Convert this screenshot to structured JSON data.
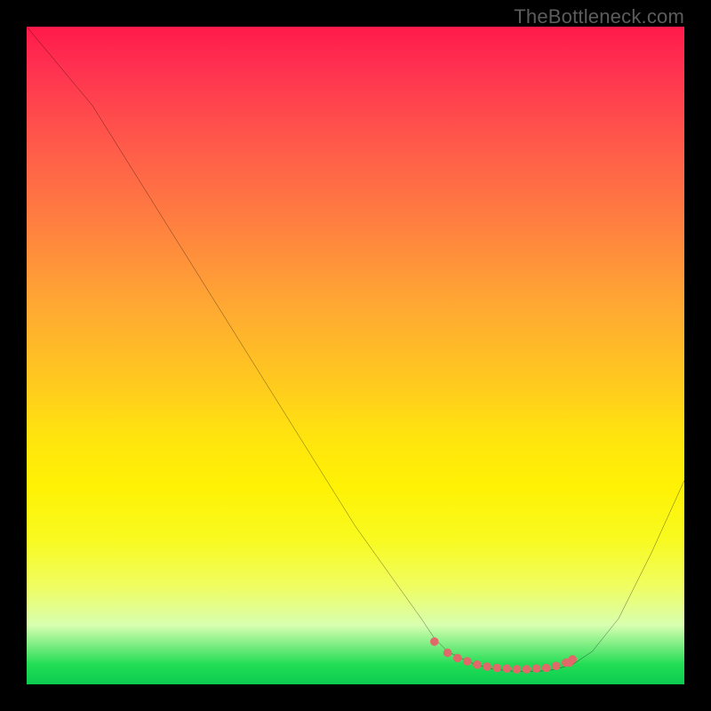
{
  "watermark": "TheBottleneck.com",
  "chart_data": {
    "type": "line",
    "title": "",
    "xlabel": "",
    "ylabel": "",
    "xlim": [
      0,
      100
    ],
    "ylim": [
      0,
      100
    ],
    "grid": false,
    "legend": false,
    "series": [
      {
        "name": "bottleneck-curve",
        "x": [
          0,
          5,
          10,
          15,
          20,
          25,
          30,
          35,
          40,
          45,
          50,
          55,
          60,
          62,
          64,
          67,
          70,
          72,
          74,
          76,
          78,
          80,
          83,
          86,
          90,
          95,
          100
        ],
        "y": [
          100,
          94,
          88,
          80,
          72,
          64,
          56,
          48,
          40,
          32,
          24,
          17,
          10,
          7,
          5,
          3.5,
          2.5,
          2.2,
          2.0,
          2.0,
          2.0,
          2.2,
          3.0,
          5.0,
          10,
          20,
          31
        ]
      }
    ],
    "highlight": {
      "name": "optimal-range-dots",
      "x": [
        62,
        64,
        65.5,
        67,
        68.5,
        70,
        71.5,
        73,
        74.5,
        76,
        77.5,
        79,
        80.5,
        82,
        82.5,
        83
      ],
      "y": [
        6.5,
        4.8,
        4.0,
        3.5,
        3.0,
        2.7,
        2.5,
        2.4,
        2.3,
        2.3,
        2.4,
        2.5,
        2.8,
        3.3,
        3.3,
        3.8
      ]
    },
    "gradient_colors": {
      "top": "#ff1a4a",
      "mid_upper": "#ff8040",
      "mid": "#ffe30f",
      "mid_lower": "#f0fd60",
      "bottom": "#0ccc50"
    }
  }
}
